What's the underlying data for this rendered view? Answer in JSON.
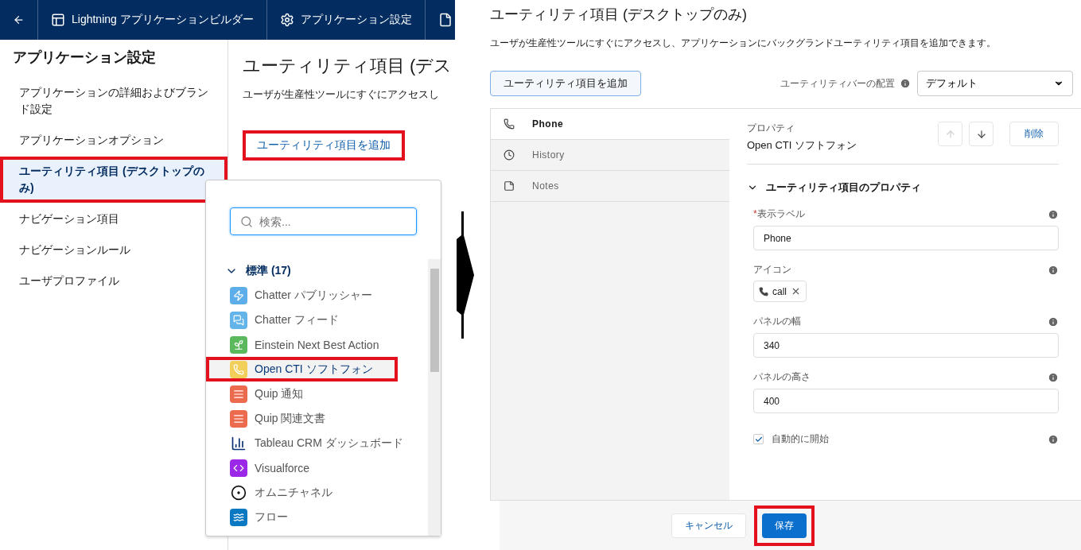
{
  "left_screen": {
    "nav": [
      {
        "kind": "back"
      },
      {
        "kind": "builder",
        "label": "Lightning アプリケーションビルダー"
      },
      {
        "kind": "settings",
        "label": "アプリケーション設定"
      },
      {
        "kind": "page"
      }
    ],
    "sidebar": {
      "heading": "アプリケーション設定",
      "items": [
        {
          "label": "アプリケーションの詳細およびブランド設定",
          "selected": false,
          "highlighted": false
        },
        {
          "label": "アプリケーションオプション",
          "selected": false,
          "highlighted": false
        },
        {
          "label": "ユーティリティ項目 (デスクトップのみ)",
          "selected": true,
          "highlighted": true
        },
        {
          "label": "ナビゲーション項目",
          "selected": false,
          "highlighted": false
        },
        {
          "label": "ナビゲーションルール",
          "selected": false,
          "highlighted": false
        },
        {
          "label": "ユーザプロファイル",
          "selected": false,
          "highlighted": false
        }
      ]
    },
    "main": {
      "title": "ユーティリティ項目 (デス",
      "description": "ユーザが生産性ツールにすぐにアクセスし",
      "add_button": {
        "label": "ユーティリティ項目を追加",
        "highlighted": true
      }
    },
    "popover": {
      "search_placeholder": "検索...",
      "group": {
        "label": "標準 (17)",
        "expanded": true
      },
      "items": [
        {
          "kind": "lightning",
          "label": "Chatter パブリッシャー",
          "selected": false,
          "highlighted": false
        },
        {
          "kind": "chatter",
          "label": "Chatter フィード",
          "selected": false,
          "highlighted": false
        },
        {
          "kind": "einstein",
          "label": "Einstein Next Best Action",
          "selected": false,
          "highlighted": false
        },
        {
          "kind": "phone",
          "label": "Open CTI ソフトフォン",
          "selected": true,
          "highlighted": true
        },
        {
          "kind": "quip",
          "label": "Quip 通知",
          "selected": false,
          "highlighted": false
        },
        {
          "kind": "quip",
          "label": "Quip 関連文書",
          "selected": false,
          "highlighted": false
        },
        {
          "kind": "chart",
          "label": "Tableau CRM ダッシュボード",
          "selected": false,
          "highlighted": false
        },
        {
          "kind": "code",
          "label": "Visualforce",
          "selected": false,
          "highlighted": false
        },
        {
          "kind": "omni",
          "label": "オムニチャネル",
          "selected": false,
          "highlighted": false
        },
        {
          "kind": "flow",
          "label": "フロー",
          "selected": false,
          "highlighted": false
        }
      ]
    }
  },
  "right_screen": {
    "title": "ユーティリティ項目 (デスクトップのみ)",
    "description": "ユーザが生産性ツールにすぐにアクセスし、アプリケーションにバックグランドユーティリティ項目を追加できます。",
    "add_button": "ユーティリティ項目を追加",
    "placement_label": "ユーティリティバーの配置",
    "placement_value": "デフォルト",
    "utilities": [
      {
        "kind": "phone",
        "label": "Phone",
        "selected": true
      },
      {
        "kind": "history",
        "label": "History",
        "selected": false
      },
      {
        "kind": "notes",
        "label": "Notes",
        "selected": false
      }
    ],
    "properties": {
      "caption": "プロパティ",
      "name": "Open CTI ソフトフォン",
      "up_disabled": true,
      "down_disabled": false,
      "delete_button": "削除"
    },
    "section": {
      "label": "ユーティリティ項目のプロパティ",
      "expanded": true
    },
    "fields": [
      {
        "kind": "text",
        "label": "表示ラベル",
        "required_mark": "*",
        "value": "Phone"
      },
      {
        "kind": "icon",
        "label": "アイコン",
        "value": "call"
      },
      {
        "kind": "text",
        "label": "パネルの幅",
        "value": "340"
      },
      {
        "kind": "text",
        "label": "パネルの高さ",
        "value": "400"
      },
      {
        "kind": "checkbox",
        "label": "自動的に開始",
        "checked": true
      }
    ],
    "footer": {
      "cancel": "キャンセル",
      "save": {
        "label": "保存",
        "highlighted": true
      }
    }
  }
}
